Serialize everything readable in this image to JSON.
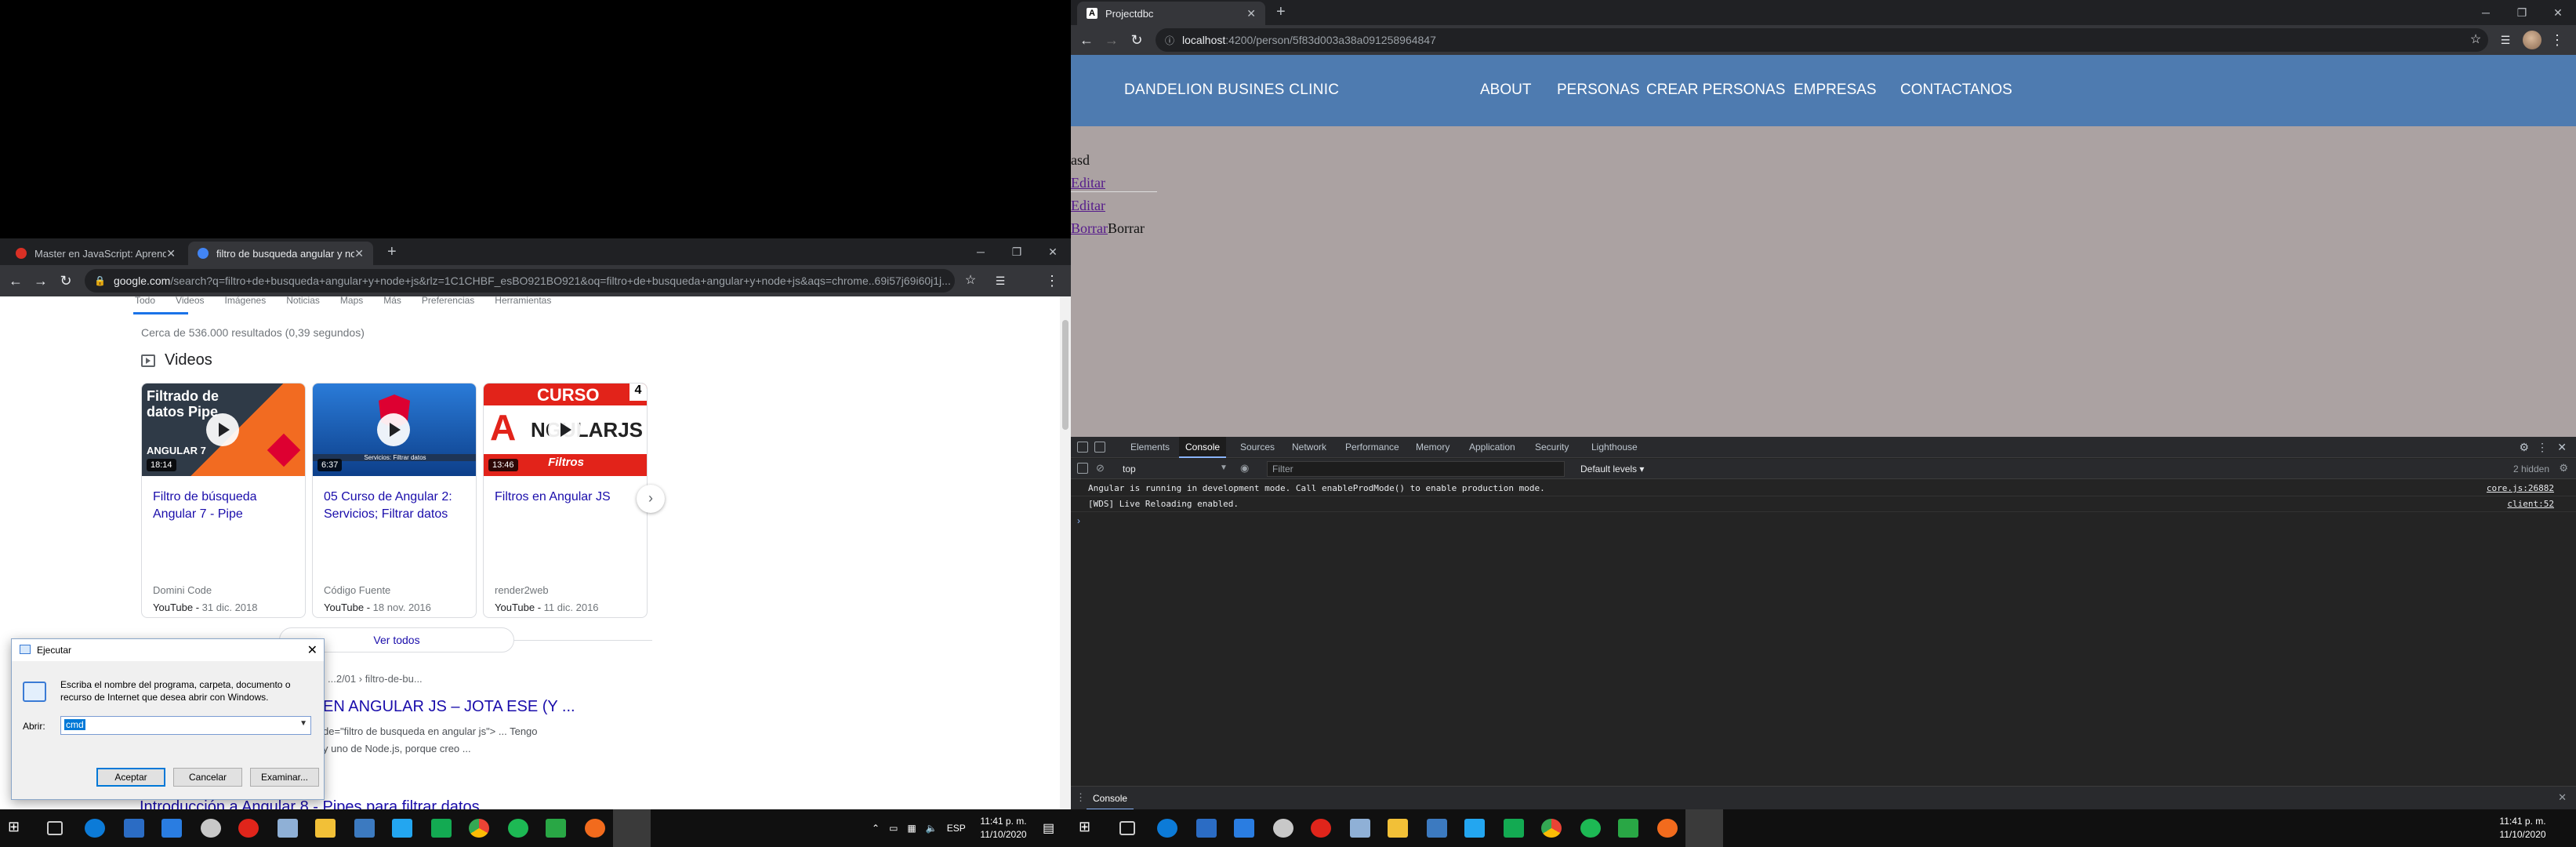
{
  "left_browser": {
    "tabs": [
      {
        "label": "Master en JavaScript: Aprender JS...",
        "favicon_color": "#d93025"
      },
      {
        "label": "filtro de busqueda angular y node...",
        "favicon_color": "#4285f4"
      }
    ],
    "url": {
      "host": "google.com",
      "path": "/search?q=filtro+de+busqueda+angular+y+node+js&rlz=1C1CHBF_esBO921BO921&oq=filtro+de+busqueda+angular+y+node+js&aqs=chrome..69i57j69i60j1j..."
    },
    "google": {
      "search_tabs": [
        "Todo",
        "Videos",
        "Imágenes",
        "Noticias",
        "Maps",
        "Más",
        "Preferencias",
        "Herramientas"
      ],
      "result_count": "Cerca de 536.000 resultados (0,39 segundos)",
      "videos_heading": "Videos",
      "videos": [
        {
          "title": "Filtro de búsqueda Angular 7 - Pipe",
          "duration": "18:14",
          "author": "Domini Code",
          "source": "YouTube",
          "date": "31 dic. 2018",
          "thumb_text": "Filtrado de datos Pipe",
          "thumb_sub": "ANGULAR 7"
        },
        {
          "title": "05 Curso de Angular 2: Servicios; Filtrar datos",
          "duration": "6:37",
          "author": "Código Fuente",
          "source": "YouTube",
          "date": "18 nov. 2016",
          "thumb_text": "Servicios: Filtrar datos"
        },
        {
          "title": "Filtros en Angular JS",
          "duration": "13:46",
          "author": "render2web",
          "source": "YouTube",
          "date": "11 dic. 2016",
          "thumb_text": "CURSO",
          "thumb_badge": "4",
          "thumb_sub": "Filtros"
        }
      ],
      "ver_todos": "Ver todos",
      "result": {
        "url": "...2/01 › filtro-de-bu...",
        "title": "EN ANGULAR JS – JOTA ESE (Y ...",
        "snippet_1": "de=\"filtro de busqueda en angular js\"> ... Tengo",
        "snippet_2": "y uno de Node.js, porque creo ..."
      },
      "next_title": "Introducción a Angular 8 - Pipes para filtrar datos"
    }
  },
  "run_dialog": {
    "title": "Ejecutar",
    "description": "Escriba el nombre del programa, carpeta, documento o recurso de Internet que desea abrir con Windows.",
    "open_label": "Abrir:",
    "open_value": "cmd",
    "ok_label": "Aceptar",
    "cancel_label": "Cancelar",
    "browse_label": "Examinar..."
  },
  "left_taskbar": {
    "tray_lang": "ESP",
    "time": "11:41 p. m.",
    "date": "11/10/2020"
  },
  "right_browser": {
    "tab_label": "Projectdbc",
    "url_host": "localhost",
    "url_rest": ":4200/person/5f83d003a38a091258964847",
    "app": {
      "brand": "DANDELION BUSINES CLINIC",
      "nav": [
        "ABOUT",
        "PERSONAS",
        "CREAR PERSONAS",
        "EMPRESAS",
        "CONTACTANOS"
      ],
      "name_text": "asd",
      "edit_link_1": "Editar",
      "edit_link_2": "Editar",
      "delete_link": "Borrar",
      "delete_text": "Borrar"
    },
    "devtools": {
      "tabs": [
        "Elements",
        "Console",
        "Sources",
        "Network",
        "Performance",
        "Memory",
        "Application",
        "Security",
        "Lighthouse"
      ],
      "active_tab": "Console",
      "context": "top",
      "filter_placeholder": "Filter",
      "levels": "Default levels ▾",
      "hidden_count": "2 hidden",
      "logs": [
        {
          "msg": "Angular is running in development mode. Call enableProdMode() to enable production mode.",
          "src": "core.js:26882"
        },
        {
          "msg": "[WDS] Live Reloading enabled.",
          "src": "client:52"
        }
      ],
      "drawer_tab": "Console"
    }
  },
  "right_taskbar": {
    "time": "11:41 p. m.",
    "date": "11/10/2020"
  }
}
